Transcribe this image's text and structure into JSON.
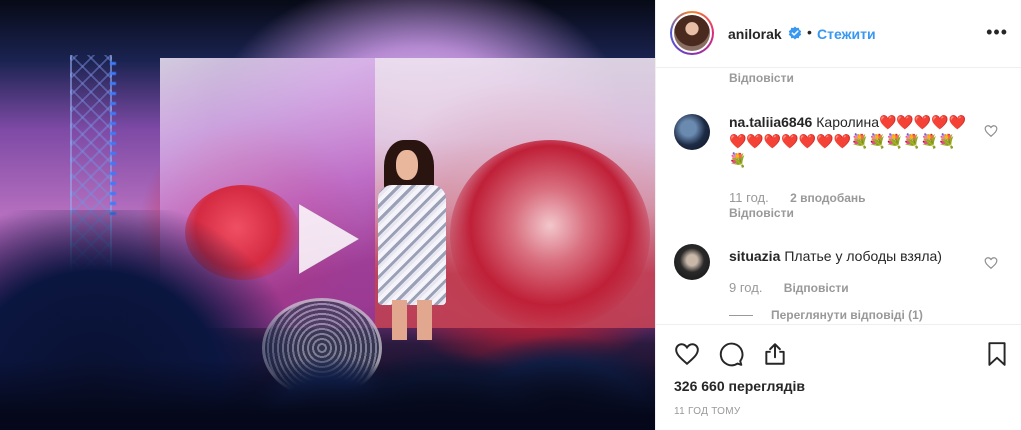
{
  "post": {
    "username": "anilorak",
    "follow_label": "Стежити",
    "separator": "•",
    "more_label": "•••"
  },
  "comments": {
    "top_reply_label": "Відповісти",
    "items": [
      {
        "username": "na.taliia6846",
        "text": "Каролина❤️❤️❤️❤️❤️❤️❤️❤️❤️❤️❤️❤️💐💐💐💐💐💐💐",
        "time": "11 год.",
        "likes": "2 вподобань",
        "reply_label": "Відповісти"
      },
      {
        "username": "situazia",
        "text": "Платье у лободы взяла)",
        "time": "9 год.",
        "reply_label": "Відповісти",
        "view_replies_label": "Переглянути відповіді (1)"
      }
    ]
  },
  "stats": {
    "views": "326 660 переглядів",
    "posted_ago": "11 ГОД ТОМУ"
  },
  "icons": {
    "verified_color": "#3897f0",
    "like": "heart-icon",
    "comment": "comment-icon",
    "share": "share-icon",
    "save": "bookmark-icon",
    "play": "play-icon"
  }
}
